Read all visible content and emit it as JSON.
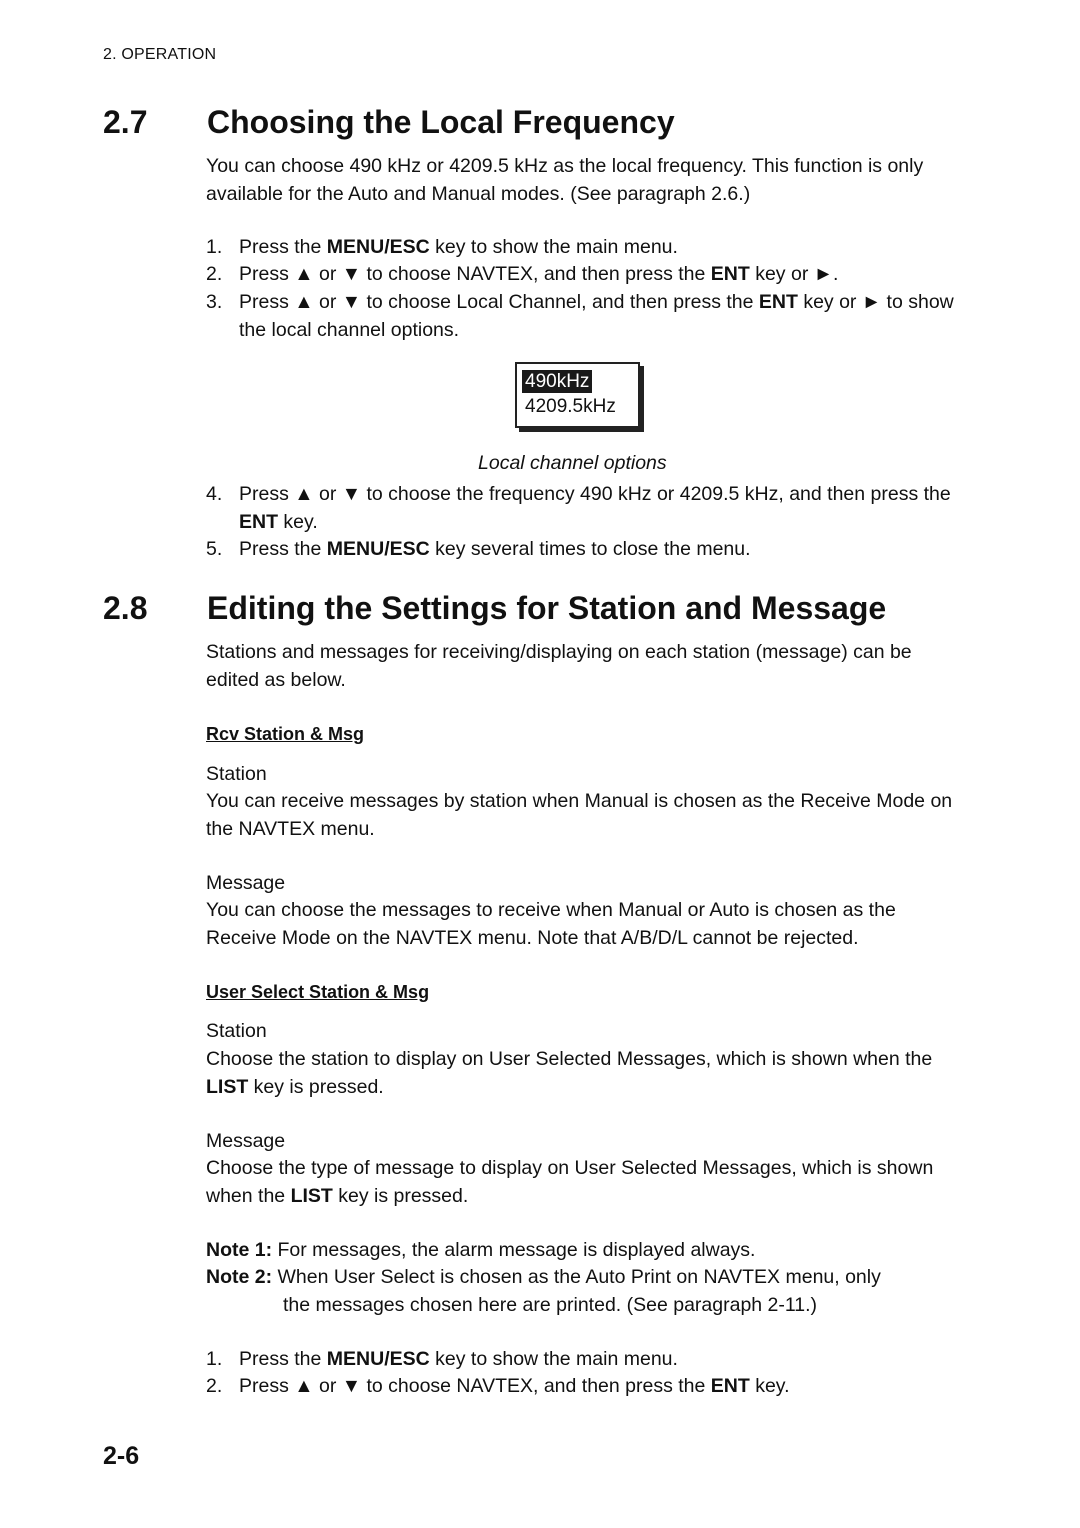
{
  "running_head": "2. OPERATION",
  "sections": [
    {
      "number": "2.7",
      "title": "Choosing the Local Frequency",
      "intro": "You can choose 490 kHz or 4209.5 kHz as the local frequency. This function is only available for the Auto and Manual modes. (See paragraph 2.6.)",
      "steps": [
        {
          "n": "1.",
          "pre": "Press the ",
          "key": "MENU/ESC",
          "post": " key to show the main menu."
        },
        {
          "n": "2.",
          "pre": "Press ▲ or ▼ to choose NAVTEX, and then press the ",
          "key": "ENT",
          "post": " key or ►."
        },
        {
          "n": "3.",
          "pre": "Press ▲ or ▼ to choose Local Channel, and then press the ",
          "key": "ENT",
          "post": " key or ► to show the local channel options."
        }
      ],
      "figure": {
        "options": [
          "490kHz",
          "4209.5kHz"
        ],
        "selected": "490kHz",
        "caption": "Local channel options"
      },
      "steps_after": [
        {
          "n": "4.",
          "pre": "Press ▲ or ▼ to choose the frequency 490 kHz or 4209.5 kHz, and then press the ",
          "key": "ENT",
          "post": " key."
        },
        {
          "n": "5.",
          "pre": "Press the ",
          "key": "MENU/ESC",
          "post": " key several times to close the menu."
        }
      ]
    },
    {
      "number": "2.8",
      "title": "Editing the Settings for Station and Message",
      "intro": "Stations and messages for receiving/displaying on each station (message) can be edited as below.",
      "subsections": [
        {
          "heading": "Rcv Station & Msg",
          "items": [
            {
              "label": "Station",
              "text": "You can receive messages by station when Manual is chosen as the Receive Mode on the NAVTEX menu."
            },
            {
              "label": "Message",
              "text": "You can choose the messages to receive when Manual or Auto is chosen as the Receive Mode on the NAVTEX menu. Note that A/B/D/L cannot be rejected."
            }
          ]
        },
        {
          "heading": "User Select Station & Msg",
          "items": [
            {
              "label": "Station",
              "pre": "Choose the station to display on User Selected Messages, which is shown when the ",
              "key": "LIST",
              "post": " key is pressed."
            },
            {
              "label": "Message",
              "pre": "Choose the type of message to display on User Selected Messages, which is shown when the ",
              "key": "LIST",
              "post": " key is pressed."
            }
          ]
        }
      ],
      "notes": [
        {
          "label": "Note 1:",
          "text": "For messages, the alarm message is displayed always."
        },
        {
          "label": "Note 2:",
          "text": "When User Select is chosen as the Auto Print on NAVTEX menu, only",
          "cont": "the messages chosen here are printed. (See paragraph 2-11.)"
        }
      ],
      "steps": [
        {
          "n": "1.",
          "pre": "Press the ",
          "key": "MENU/ESC",
          "post": " key to show the main menu."
        },
        {
          "n": "2.",
          "pre": "Press ▲ or ▼ to choose NAVTEX, and then press the ",
          "key": "ENT",
          "post": " key."
        }
      ]
    }
  ],
  "page_number": "2-6"
}
